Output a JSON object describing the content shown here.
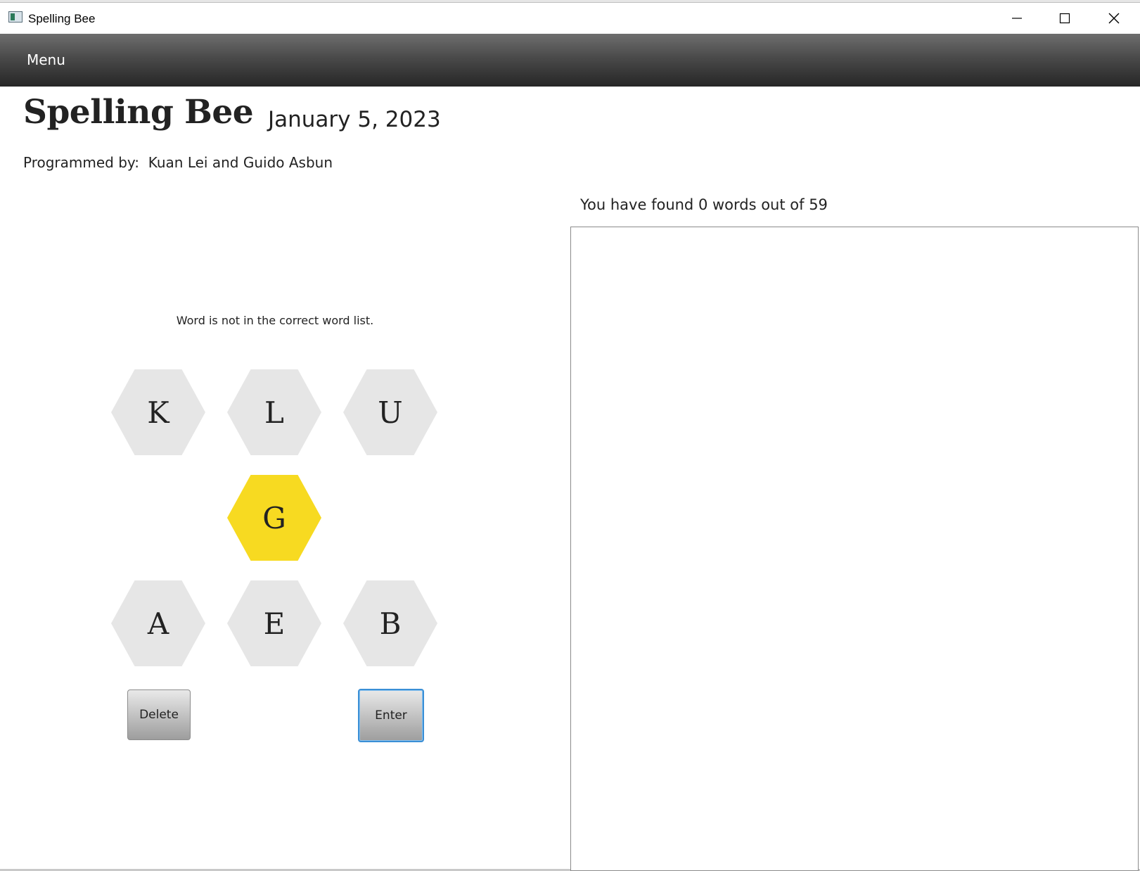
{
  "window": {
    "title": "Spelling Bee"
  },
  "menubar": {
    "menu_label": "Menu"
  },
  "header": {
    "title": "Spelling Bee",
    "date": "January 5, 2023",
    "programmed_by": "Programmed by:  Kuan Lei and Guido Asbun"
  },
  "game": {
    "message": "Word is not in the correct word list.",
    "letters": {
      "top_left": "K",
      "top_middle": "L",
      "top_right": "U",
      "center": "G",
      "bottom_left": "A",
      "bottom_middle": "E",
      "bottom_right": "B"
    },
    "delete_label": "Delete",
    "enter_label": "Enter",
    "center_color": "#f7da21",
    "outer_color": "#e6e6e6"
  },
  "words_panel": {
    "found_text": "You have found 0 words out of 59",
    "found_words": []
  }
}
